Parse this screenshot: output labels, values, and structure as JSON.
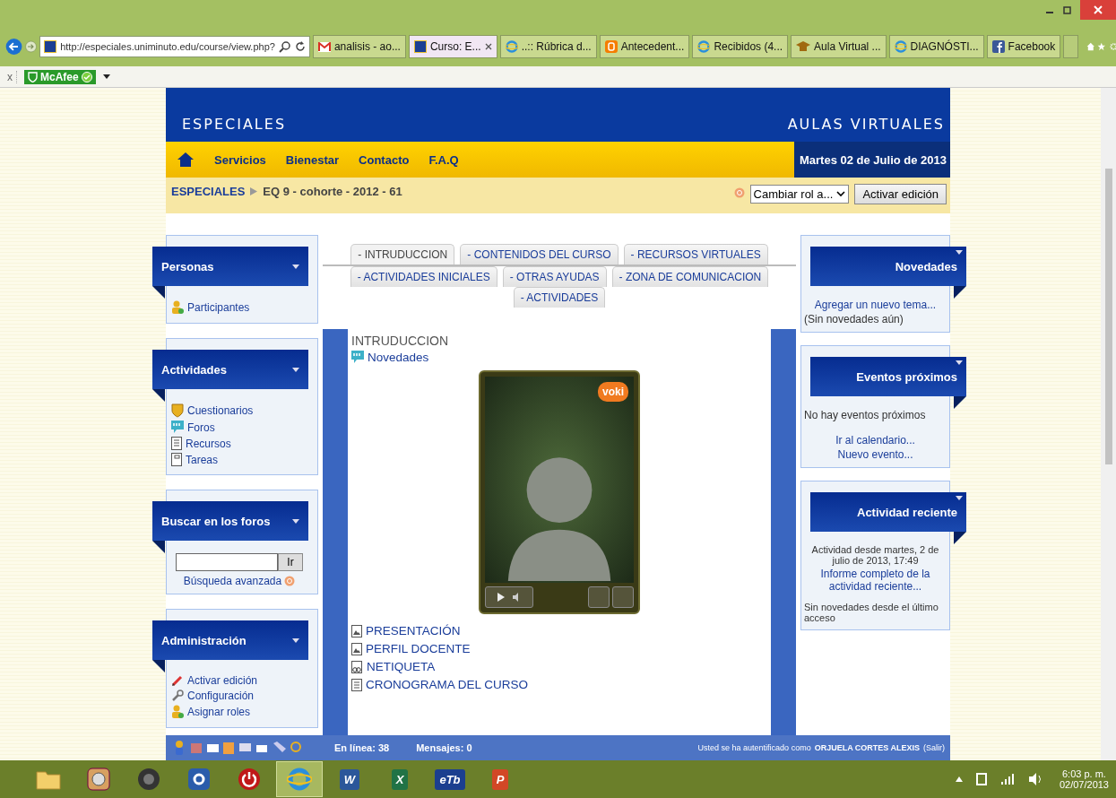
{
  "browser": {
    "address": "http://especiales.uniminuto.edu/course/view.php?",
    "tabs": [
      {
        "label": "analisis - ao...",
        "kind": "mail",
        "selected": false
      },
      {
        "label": "Curso: E...",
        "kind": "site",
        "selected": true
      },
      {
        "label": "..:: Rúbrica d...",
        "kind": "ie",
        "selected": false
      },
      {
        "label": "Antecedent...",
        "kind": "blog",
        "selected": false
      },
      {
        "label": "Recibidos (4...",
        "kind": "ie",
        "selected": false
      },
      {
        "label": "Aula Virtual ...",
        "kind": "cap",
        "selected": false
      },
      {
        "label": "DIAGNÓSTI...",
        "kind": "ie",
        "selected": false
      },
      {
        "label": "Facebook",
        "kind": "social",
        "selected": false
      }
    ],
    "toolbar": {
      "close": "x",
      "addon": "McAfee"
    }
  },
  "header": {
    "left": "ESPECIALES",
    "right": "AULAS VIRTUALES"
  },
  "nav": {
    "links": [
      "Servicios",
      "Bienestar",
      "Contacto",
      "F.A.Q"
    ],
    "date": "Martes 02 de Julio de 2013"
  },
  "breadcrumb": {
    "root": "ESPECIALES",
    "current": "EQ 9 - cohorte - 2012 - 61",
    "role_select": "Cambiar rol a...",
    "edit_button": "Activar edición"
  },
  "left_blocks": [
    {
      "title": "Personas",
      "kind": "links",
      "items": [
        {
          "label": "Participantes",
          "kind": "participants"
        }
      ]
    },
    {
      "title": "Actividades",
      "kind": "links",
      "items": [
        {
          "label": "Cuestionarios",
          "kind": "quiz"
        },
        {
          "label": "Foros",
          "kind": "forum"
        },
        {
          "label": "Recursos",
          "kind": "resource"
        },
        {
          "label": "Tareas",
          "kind": "assignment"
        }
      ]
    },
    {
      "title": "Buscar en los foros",
      "kind": "search",
      "button": "Ir",
      "link": "Búsqueda avanzada"
    },
    {
      "title": "Administración",
      "kind": "links",
      "items": [
        {
          "label": "Activar edición",
          "kind": "edit"
        },
        {
          "label": "Configuración",
          "kind": "settings"
        },
        {
          "label": "Asignar roles",
          "kind": "roles"
        }
      ]
    }
  ],
  "course_tabs": [
    [
      {
        "label": "- INTRUDUCCION",
        "selected": true
      },
      {
        "label": "- CONTENIDOS DEL CURSO",
        "selected": false
      },
      {
        "label": "- RECURSOS VIRTUALES",
        "selected": false
      }
    ],
    [
      {
        "label": "- ACTIVIDADES INICIALES",
        "selected": false
      },
      {
        "label": "- OTRAS AYUDAS",
        "selected": false
      },
      {
        "label": "- ZONA DE COMUNICACION",
        "selected": false
      }
    ],
    [
      {
        "label": "- ACTIVIDADES",
        "selected": false
      }
    ]
  ],
  "section": {
    "title": "INTRUDUCCION",
    "forum": "Novedades",
    "widget_badge": "voki",
    "resources": [
      {
        "label": "PRESENTACIÓN",
        "kind": "file"
      },
      {
        "label": "PERFIL DOCENTE",
        "kind": "file"
      },
      {
        "label": "NETIQUETA",
        "kind": "link"
      },
      {
        "label": "CRONOGRAMA DEL CURSO",
        "kind": "page"
      }
    ]
  },
  "right_blocks": [
    {
      "title": "Novedades",
      "lines": [
        {
          "text": "Agregar un nuevo tema...",
          "kind": "link"
        },
        {
          "text": "(Sin novedades aún)",
          "kind": "text"
        }
      ]
    },
    {
      "title": "Eventos próximos",
      "lines": [
        {
          "text": "No hay eventos próximos",
          "kind": "text"
        },
        {
          "text": "Ir al calendario...",
          "kind": "link"
        },
        {
          "text": "Nuevo evento...",
          "kind": "link"
        }
      ]
    },
    {
      "title": "Actividad reciente",
      "lines": [
        {
          "text": "Actividad desde martes, 2 de julio de 2013, 17:49",
          "kind": "note"
        },
        {
          "text": "Informe completo de la actividad reciente...",
          "kind": "link"
        },
        {
          "text": "Sin novedades desde el último acceso",
          "kind": "small"
        }
      ]
    }
  ],
  "dock": {
    "online": "En línea: 38",
    "messages": "Mensajes: 0",
    "login_text": "Usted se ha autentificado como",
    "user": "ORJUELA CORTES ALEXIS",
    "logout": "(Salir)"
  },
  "taskbar": {
    "apps": [
      {
        "kind": "folder",
        "selected": false
      },
      {
        "kind": "disk",
        "selected": false
      },
      {
        "kind": "speaker",
        "selected": false
      },
      {
        "kind": "control",
        "selected": false
      },
      {
        "kind": "power",
        "selected": false
      },
      {
        "kind": "ie",
        "selected": true
      },
      {
        "kind": "word",
        "label": "W",
        "selected": false
      },
      {
        "kind": "excel",
        "label": "X",
        "selected": false
      },
      {
        "kind": "etb",
        "label": "eTb",
        "selected": false
      },
      {
        "kind": "ppt",
        "label": "P",
        "selected": false
      }
    ],
    "time": "6:03 p. m.",
    "date": "02/07/2013"
  }
}
